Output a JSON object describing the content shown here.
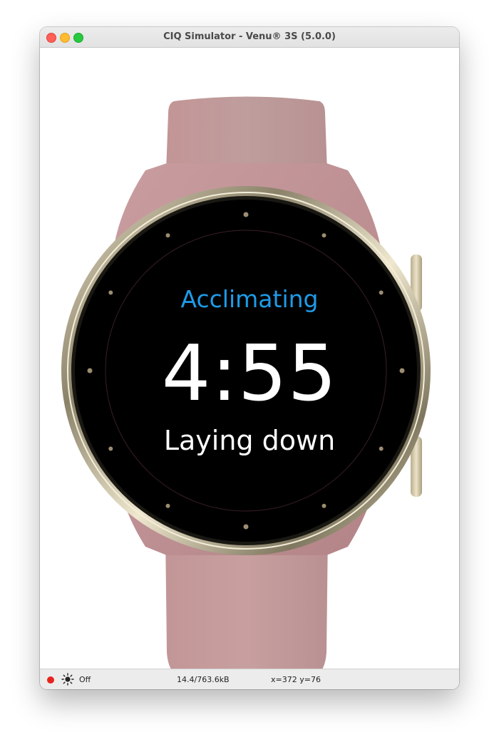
{
  "window": {
    "title": "CIQ Simulator - Venu® 3S (5.0.0)",
    "buttons": [
      "close",
      "minimize",
      "maximize"
    ]
  },
  "watch": {
    "band_color": "#c4989a",
    "bezel_color": "#cfc5a5",
    "screen": {
      "mode_label": "Acclimating",
      "mode_color": "#1e9be8",
      "timer": "4:55",
      "posture": "Laying down"
    }
  },
  "statusbar": {
    "recording_icon": "red-dot-icon",
    "backlight_icon": "sun-icon",
    "backlight_state": "Off",
    "memory": "14.4/763.6kB",
    "cursor": "x=372 y=76"
  }
}
